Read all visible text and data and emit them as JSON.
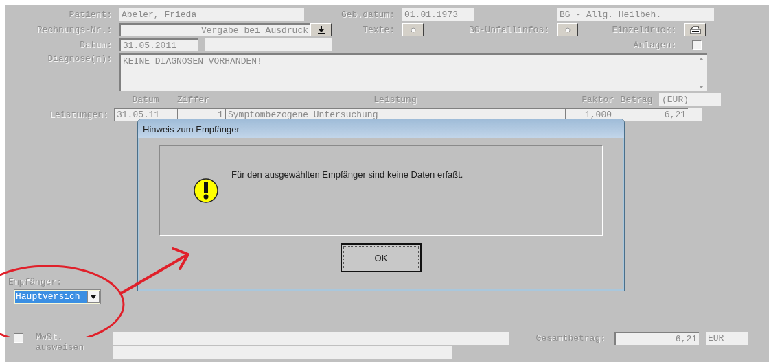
{
  "form": {
    "patient": {
      "label": "Patient:",
      "value": "Abeler, Frieda"
    },
    "birth_date": {
      "label": "Geb.datum:",
      "value": "01.01.1973"
    },
    "billing_type": {
      "value": "BG - Allg. Heilbeh."
    },
    "invoice_number": {
      "label": "Rechnungs-Nr.:",
      "value": "Vergabe bei Ausdruck"
    },
    "texts": {
      "label": "Texte:"
    },
    "bg_accident_info": {
      "label": "BG-Unfallinfos:"
    },
    "single_print": {
      "label": "Einzeldruck:"
    },
    "date": {
      "label": "Datum:",
      "value": "31.05.2011"
    },
    "attachments": {
      "label": "Anlagen:",
      "checked": false
    },
    "diagnoses": {
      "label": "Diagnose(n):",
      "value": "KEINE DIAGNOSEN VORHANDEN!"
    }
  },
  "services": {
    "label": "Leistungen:",
    "columns": [
      "Datum",
      "Ziffer",
      "Leistung",
      "Faktor",
      "Betrag",
      "(EUR)"
    ],
    "rows": [
      {
        "date": "31.05.11",
        "code": "1",
        "description": "Symptombezogene Untersuchung",
        "factor": "1,000",
        "amount": "6,21"
      }
    ]
  },
  "recipient": {
    "label": "Empfänger:",
    "value": "Hauptversich"
  },
  "vat": {
    "label": "MwSt. ausweisen",
    "checked": false
  },
  "total": {
    "label": "Gesamtbetrag:",
    "value": "6,21",
    "currency": "EUR"
  },
  "dialog": {
    "title": "Hinweis zum Empfänger",
    "message": "Für den ausgewählten Empfänger sind keine Daten erfaßt.",
    "button": "OK"
  }
}
